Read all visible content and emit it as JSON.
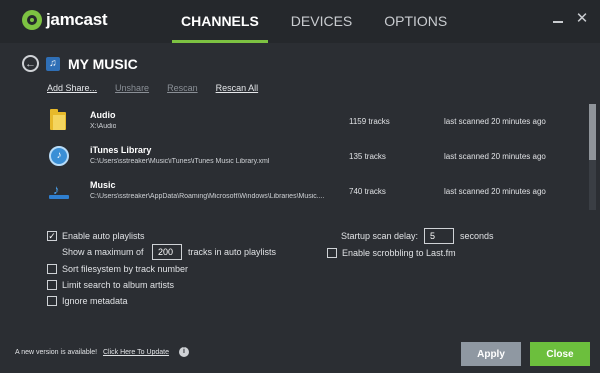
{
  "app": {
    "logo_text": "jamcast"
  },
  "nav": {
    "tabs": [
      {
        "label": "CHANNELS"
      },
      {
        "label": "DEVICES"
      },
      {
        "label": "OPTIONS"
      }
    ]
  },
  "window": {
    "close_glyph": "✕"
  },
  "header": {
    "title": "MY MUSIC",
    "back_glyph": "←",
    "music_glyph": "♫"
  },
  "actions": {
    "add_share": "Add Share...",
    "unshare": "Unshare",
    "rescan": "Rescan",
    "rescan_all": "Rescan All"
  },
  "libraries": [
    {
      "name": "Audio",
      "path": "X:\\Audio",
      "tracks": "1159 tracks",
      "scanned": "last scanned 20 minutes ago",
      "icon": "folder-icon"
    },
    {
      "name": "iTunes Library",
      "path": "C:\\Users\\sstreaker\\Music\\iTunes\\iTunes Music Library.xml",
      "tracks": "135 tracks",
      "scanned": "last scanned 20 minutes ago",
      "icon": "itunes-icon"
    },
    {
      "name": "Music",
      "path": "C:\\Users\\sstreaker\\AppData\\Roaming\\Microsoft\\Windows\\Libraries\\Music....",
      "tracks": "740 tracks",
      "scanned": "last scanned 20 minutes ago",
      "icon": "music-library-icon"
    }
  ],
  "settings": {
    "enable_auto_playlists": {
      "label": "Enable auto playlists",
      "checked": true
    },
    "max_tracks_prefix": "Show a maximum of",
    "max_tracks_value": "200",
    "max_tracks_suffix": "tracks in auto playlists",
    "sort_filesystem": {
      "label": "Sort filesystem by track number",
      "checked": false
    },
    "limit_search": {
      "label": "Limit search to album artists",
      "checked": false
    },
    "ignore_metadata": {
      "label": "Ignore metadata",
      "checked": false
    },
    "startup_delay_label": "Startup scan delay:",
    "startup_delay_value": "5",
    "startup_delay_suffix": "seconds",
    "scrobbling": {
      "label": "Enable scrobbling to Last.fm",
      "checked": false
    },
    "check_glyph": "✓"
  },
  "footer": {
    "update_note": "A new version is available!",
    "update_link": "Click Here To Update",
    "info_glyph": "i",
    "apply_label": "Apply",
    "close_label": "Close"
  },
  "colors": {
    "accent": "#7dc242",
    "background": "#2b2e33",
    "apply": "#8f98a2",
    "close": "#6cbf3d"
  }
}
